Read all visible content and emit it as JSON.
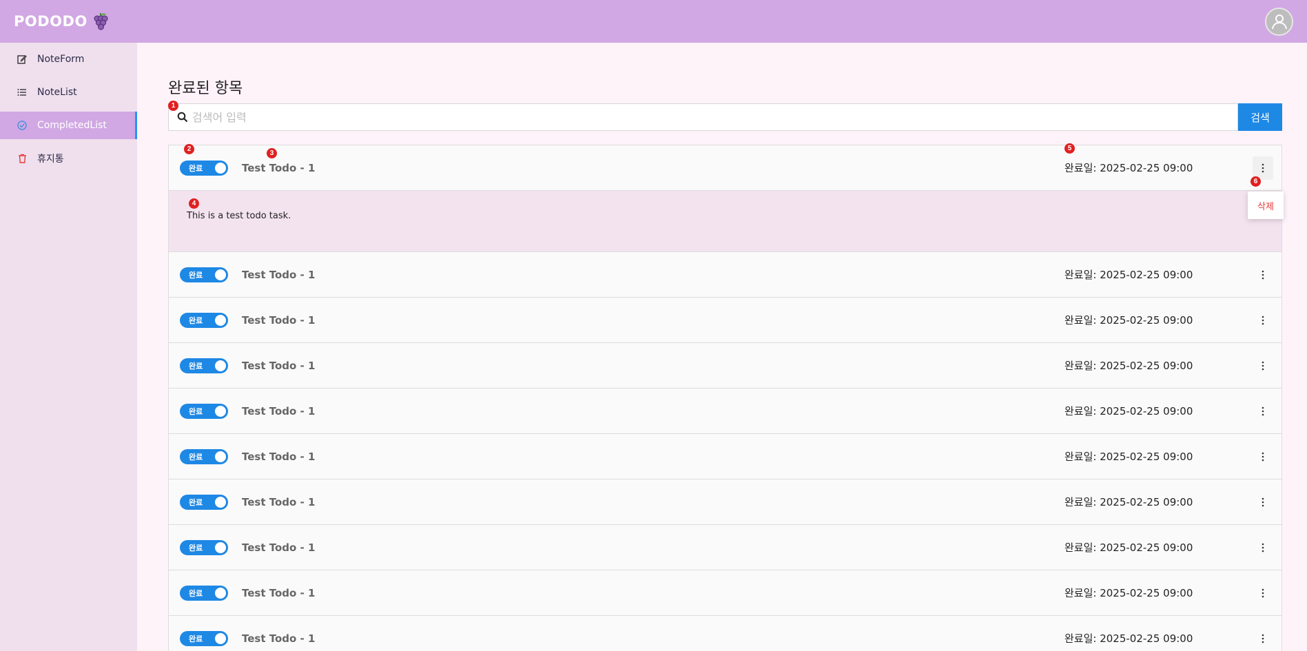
{
  "header": {
    "brand": "PODODO"
  },
  "sidebar": {
    "items": [
      {
        "label": "NoteForm",
        "icon": "edit-icon",
        "active": false
      },
      {
        "label": "NoteList",
        "icon": "list-icon",
        "active": false
      },
      {
        "label": "CompletedList",
        "icon": "check-circle-icon",
        "active": true
      },
      {
        "label": "휴지통",
        "icon": "trash-icon",
        "active": false
      }
    ]
  },
  "main": {
    "title": "완료된 항목",
    "search": {
      "placeholder": "검색어 입력",
      "button_label": "검색"
    },
    "todos": [
      {
        "toggle_label": "완료",
        "title": "Test Todo - 1",
        "date_label": "완료일: 2025-02-25 09:00",
        "expanded": true,
        "description": "This is a test todo task."
      },
      {
        "toggle_label": "완료",
        "title": "Test Todo - 1",
        "date_label": "완료일: 2025-02-25 09:00"
      },
      {
        "toggle_label": "완료",
        "title": "Test Todo - 1",
        "date_label": "완료일: 2025-02-25 09:00"
      },
      {
        "toggle_label": "완료",
        "title": "Test Todo - 1",
        "date_label": "완료일: 2025-02-25 09:00"
      },
      {
        "toggle_label": "완료",
        "title": "Test Todo - 1",
        "date_label": "완료일: 2025-02-25 09:00"
      },
      {
        "toggle_label": "완료",
        "title": "Test Todo - 1",
        "date_label": "완료일: 2025-02-25 09:00"
      },
      {
        "toggle_label": "완료",
        "title": "Test Todo - 1",
        "date_label": "완료일: 2025-02-25 09:00"
      },
      {
        "toggle_label": "완료",
        "title": "Test Todo - 1",
        "date_label": "완료일: 2025-02-25 09:00"
      },
      {
        "toggle_label": "완료",
        "title": "Test Todo - 1",
        "date_label": "완료일: 2025-02-25 09:00"
      },
      {
        "toggle_label": "완료",
        "title": "Test Todo - 1",
        "date_label": "완료일: 2025-02-25 09:00"
      }
    ],
    "menu": {
      "delete_label": "삭제"
    }
  },
  "markers": [
    "1",
    "2",
    "3",
    "4",
    "5",
    "6"
  ],
  "colors": {
    "header": "#d1a8e3",
    "sidebar": "#f0e0ee",
    "accent": "#1e88e5",
    "danger": "#e53935",
    "marker": "#e02020"
  }
}
